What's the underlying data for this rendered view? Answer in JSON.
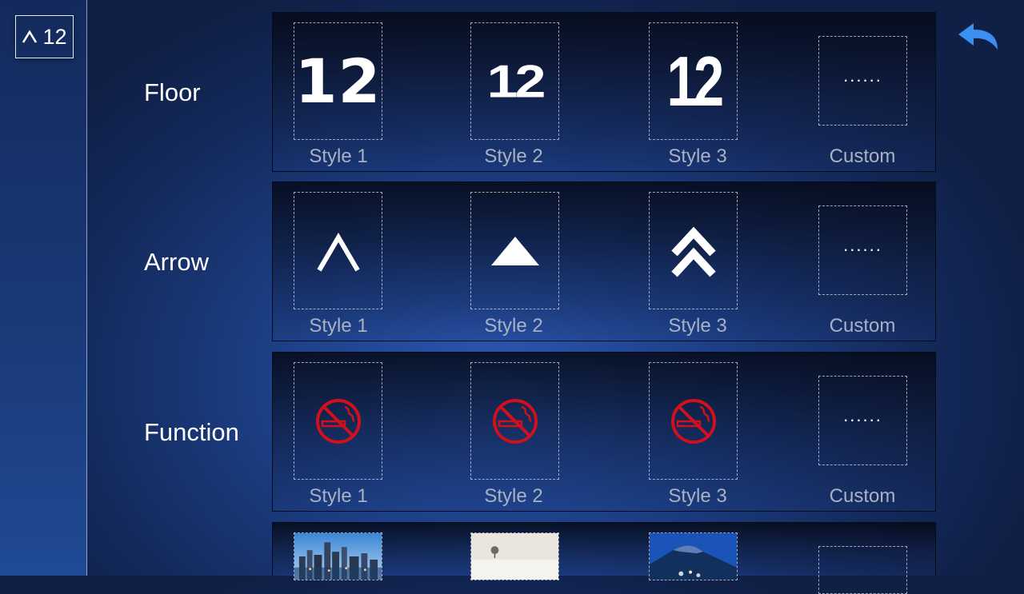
{
  "preview": {
    "floor": "12",
    "arrow_icon": "caret-up-icon"
  },
  "back_icon": "back-arrow-icon",
  "rows": {
    "floor": {
      "label": "Floor",
      "options": [
        {
          "value": "12",
          "caption": "Style 1"
        },
        {
          "value": "12",
          "caption": "Style 2"
        },
        {
          "value": "12",
          "caption": "Style 3"
        },
        {
          "value": "......",
          "caption": "Custom"
        }
      ]
    },
    "arrow": {
      "label": "Arrow",
      "options": [
        {
          "icon": "caret-up-icon",
          "caption": "Style 1"
        },
        {
          "icon": "triangle-up-icon",
          "caption": "Style 2"
        },
        {
          "icon": "double-chevron-up-icon",
          "caption": "Style 3"
        },
        {
          "value": "......",
          "caption": "Custom"
        }
      ]
    },
    "function": {
      "label": "Function",
      "options": [
        {
          "icon": "no-smoking-icon",
          "caption": "Style 1"
        },
        {
          "icon": "no-smoking-icon",
          "caption": "Style 2"
        },
        {
          "icon": "no-smoking-icon",
          "caption": "Style 3"
        },
        {
          "value": "......",
          "caption": "Custom"
        }
      ]
    },
    "background": {
      "options": [
        {
          "image": "city-skyline-thumbnail"
        },
        {
          "image": "snowy-field-tree-thumbnail"
        },
        {
          "image": "mountain-night-thumbnail"
        },
        {
          "image": "custom-empty-slot"
        }
      ]
    }
  },
  "colors": {
    "accent": "#3b8ff0",
    "no_smoking": "#d0101c",
    "caption": "#a9b1c3"
  }
}
